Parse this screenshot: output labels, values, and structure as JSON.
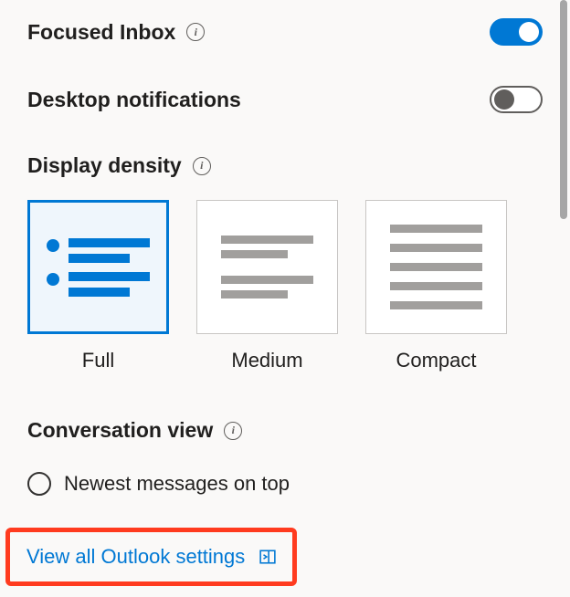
{
  "settings": {
    "focusedInbox": {
      "label": "Focused Inbox",
      "enabled": true
    },
    "desktopNotifications": {
      "label": "Desktop notifications",
      "enabled": false
    },
    "displayDensity": {
      "label": "Display density",
      "options": {
        "full": "Full",
        "medium": "Medium",
        "compact": "Compact"
      },
      "selected": "full"
    },
    "conversationView": {
      "label": "Conversation view",
      "options": {
        "newestOnTop": "Newest messages on top"
      }
    }
  },
  "footer": {
    "viewAll": "View all Outlook settings"
  }
}
